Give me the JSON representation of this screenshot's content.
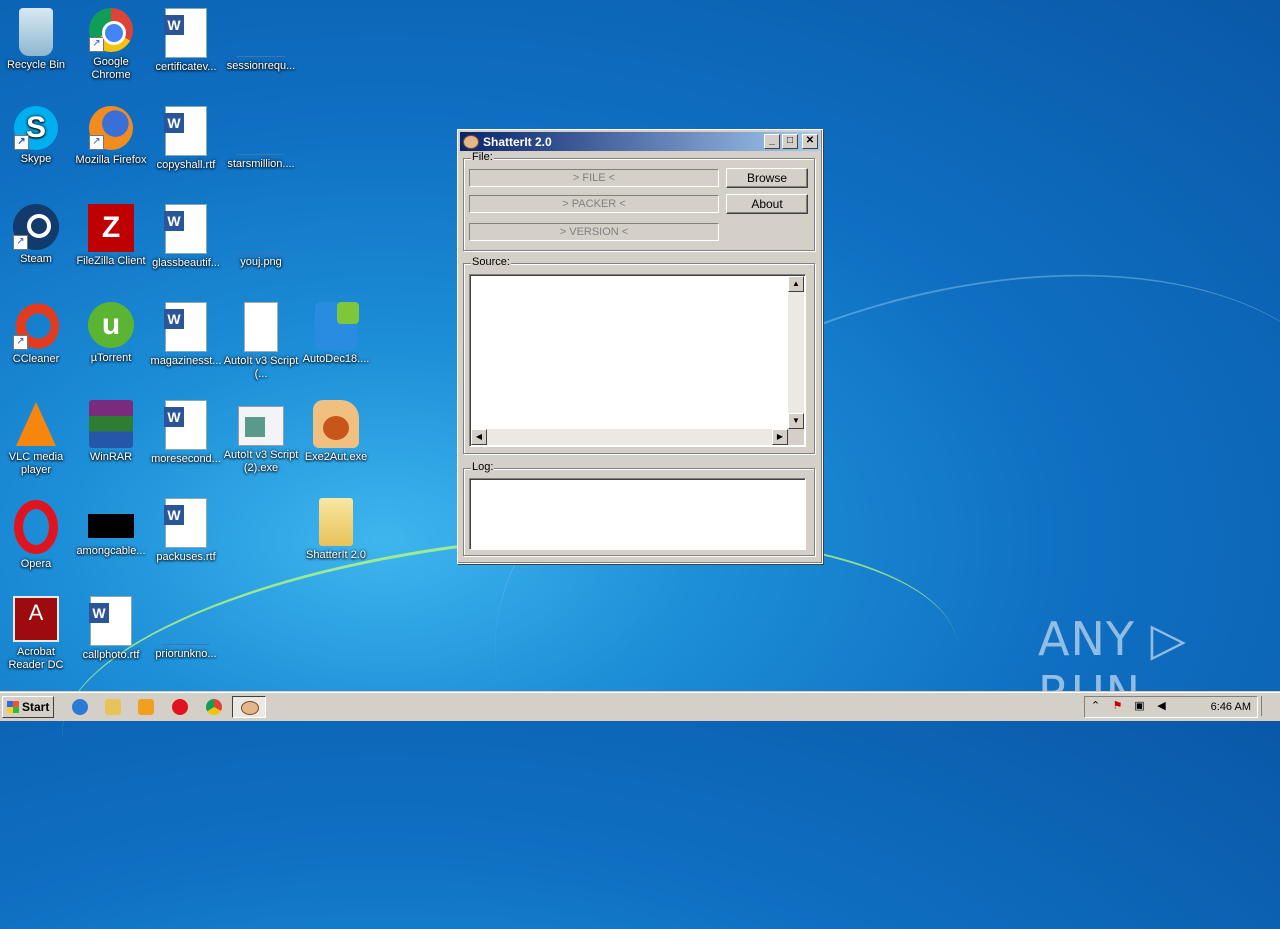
{
  "desktop": {
    "icons": [
      {
        "label": "Recycle Bin"
      },
      {
        "label": "Google Chrome"
      },
      {
        "label": "certificatev..."
      },
      {
        "label": "sessionrequ..."
      },
      {
        "label": "Skype"
      },
      {
        "label": "Mozilla Firefox"
      },
      {
        "label": "copyshall.rtf"
      },
      {
        "label": "starsmillion...."
      },
      {
        "label": "Steam"
      },
      {
        "label": "FileZilla Client"
      },
      {
        "label": "glassbeautif..."
      },
      {
        "label": "youj.png"
      },
      {
        "label": "CCleaner"
      },
      {
        "label": "µTorrent"
      },
      {
        "label": "magazinesst..."
      },
      {
        "label": "AutoIt v3 Script (..."
      },
      {
        "label": "AutoDec18...."
      },
      {
        "label": "VLC media player"
      },
      {
        "label": "WinRAR"
      },
      {
        "label": "moresecond..."
      },
      {
        "label": "AutoIt v3 Script (2).exe"
      },
      {
        "label": "Exe2Aut.exe"
      },
      {
        "label": "Opera"
      },
      {
        "label": "amongcable..."
      },
      {
        "label": "packuses.rtf"
      },
      {
        "label": "ShatterIt 2.0"
      },
      {
        "label": "Acrobat Reader DC"
      },
      {
        "label": "callphoto.rtf"
      },
      {
        "label": "priorunkno..."
      }
    ]
  },
  "window": {
    "title": "ShatterIt 2.0",
    "min_glyph": "_",
    "max_glyph": "□",
    "close_glyph": "✕",
    "file_group": {
      "label": "File:",
      "file_field": "> FILE <",
      "packer_field": "> PACKER <",
      "version_field": "> VERSION <",
      "browse_label": "Browse",
      "about_label": "About"
    },
    "source_group": {
      "label": "Source:",
      "text": ""
    },
    "log_group": {
      "label": "Log:",
      "text": ""
    }
  },
  "taskbar": {
    "start_label": "Start",
    "clock": "6:46 AM"
  },
  "watermark": {
    "text": "ANY ▷ RUN"
  }
}
